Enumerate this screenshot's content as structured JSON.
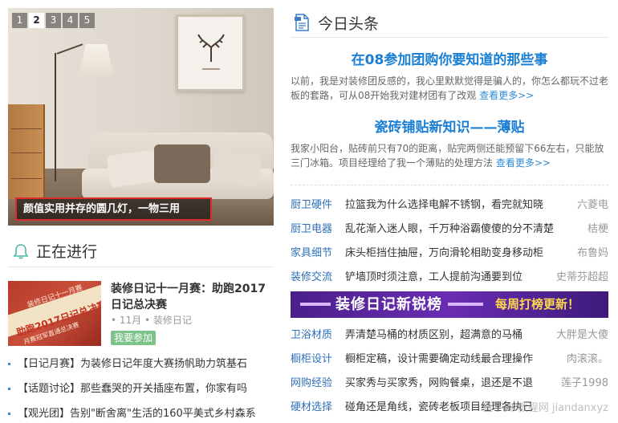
{
  "slider": {
    "pages": [
      "1",
      "2",
      "3",
      "4",
      "5"
    ],
    "active_page": "2",
    "caption": "颜值实用并存的圆几灯，一物三用"
  },
  "ongoing": {
    "title": "正在进行",
    "feature": {
      "title": "装修日记十一月赛：助跑2017日记总决赛",
      "meta": "• 11月 • 装修日记",
      "button": "我要参加",
      "thumb_text": [
        "装修日记十一月赛",
        "助跑2017日记总决赛",
        "月赛冠军直通总决赛"
      ]
    },
    "news": [
      "【日记月赛】为装修日记年度大赛扬帆助力筑基石",
      "【话题讨论】那些蠢哭的开关插座布置，你家有吗",
      "【观光团】告别\"断舍离\"生活的160平美式乡村森系"
    ]
  },
  "today": {
    "title": "今日头条",
    "headlines": [
      {
        "title": "在08参加团购你要知道的那些事",
        "summary": "以前，我是对装修团反感的，我心里默默觉得是骗人的，你怎么都玩不过老板的套路，可从08开始我对建材团有了改观",
        "more": "查看更多>>"
      },
      {
        "title": "瓷砖铺贴新知识——薄贴",
        "summary": "我家小阳台，贴砖前只有70的距离，贴完两侧还能预留下66左右，只能放三门冰箱。项目经理给了我一个薄贴的处理方法",
        "more": "查看更多>>"
      }
    ],
    "rows1": [
      {
        "cat": "厨卫硬件",
        "text": "拉篮我为什么选择电解不锈钢，看完就知晓",
        "who": "六菱电"
      },
      {
        "cat": "厨卫电器",
        "text": "乱花渐入迷人眼，千万种浴霸傻傻的分不清楚",
        "who": "桔梗"
      },
      {
        "cat": "家具细节",
        "text": "床头柜挡住抽屉，万向滑轮相助变身移动柜",
        "who": "布鲁妈"
      },
      {
        "cat": "装修交流",
        "text": "铲墙顶时须注意，工人提前沟通要到位",
        "who": "史蒂芬超超"
      }
    ],
    "banner": {
      "main": "装修日记新锐榜",
      "sub": "每周打榜更新！"
    },
    "rows2": [
      {
        "cat": "卫浴材质",
        "text": "弄清楚马桶的材质区别，超满意的马桶",
        "who": "大胖是大傻"
      },
      {
        "cat": "橱柜设计",
        "text": "橱柜定稿，设计需要确定动线最合理操作",
        "who": "肉滚滚。"
      },
      {
        "cat": "网购经验",
        "text": "买家秀与买家秀，网购餐桌，退还是不退",
        "who": "莲子1998"
      },
      {
        "cat": "硬材选择",
        "text": "碰角还是角线，瓷砖老板项目经理各执己",
        "who": ""
      }
    ]
  },
  "watermark": "查字典 教程网 jiandanxyz"
}
